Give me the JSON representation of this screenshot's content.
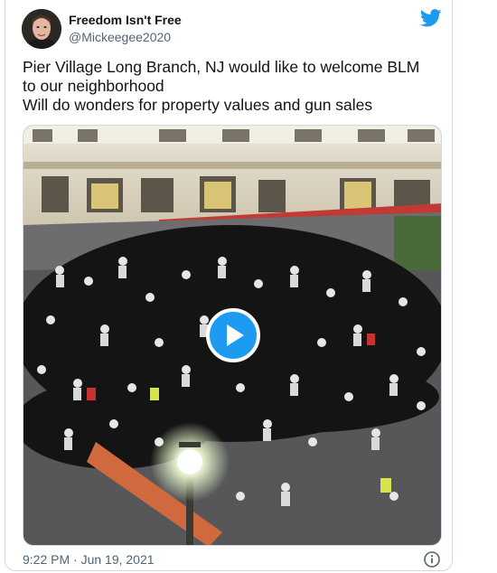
{
  "author": {
    "name": "Freedom Isn't Free",
    "handle": "@Mickeegee2020"
  },
  "tweet": {
    "lines": [
      "Pier Village Long Branch, NJ would like to welcome BLM",
      "to our neighborhood",
      "Will do wonders for property values and gun sales"
    ]
  },
  "media": {
    "type": "video",
    "play_icon": "play-icon"
  },
  "footer": {
    "timestamp": "9:22 PM · Jun 19, 2021",
    "info_icon": "info-icon"
  },
  "icons": {
    "brand": "twitter-bird-icon"
  },
  "colors": {
    "accent": "#1d9bf0",
    "text": "#0f1419",
    "secondary_text": "#536471",
    "border": "#cfd9de"
  }
}
